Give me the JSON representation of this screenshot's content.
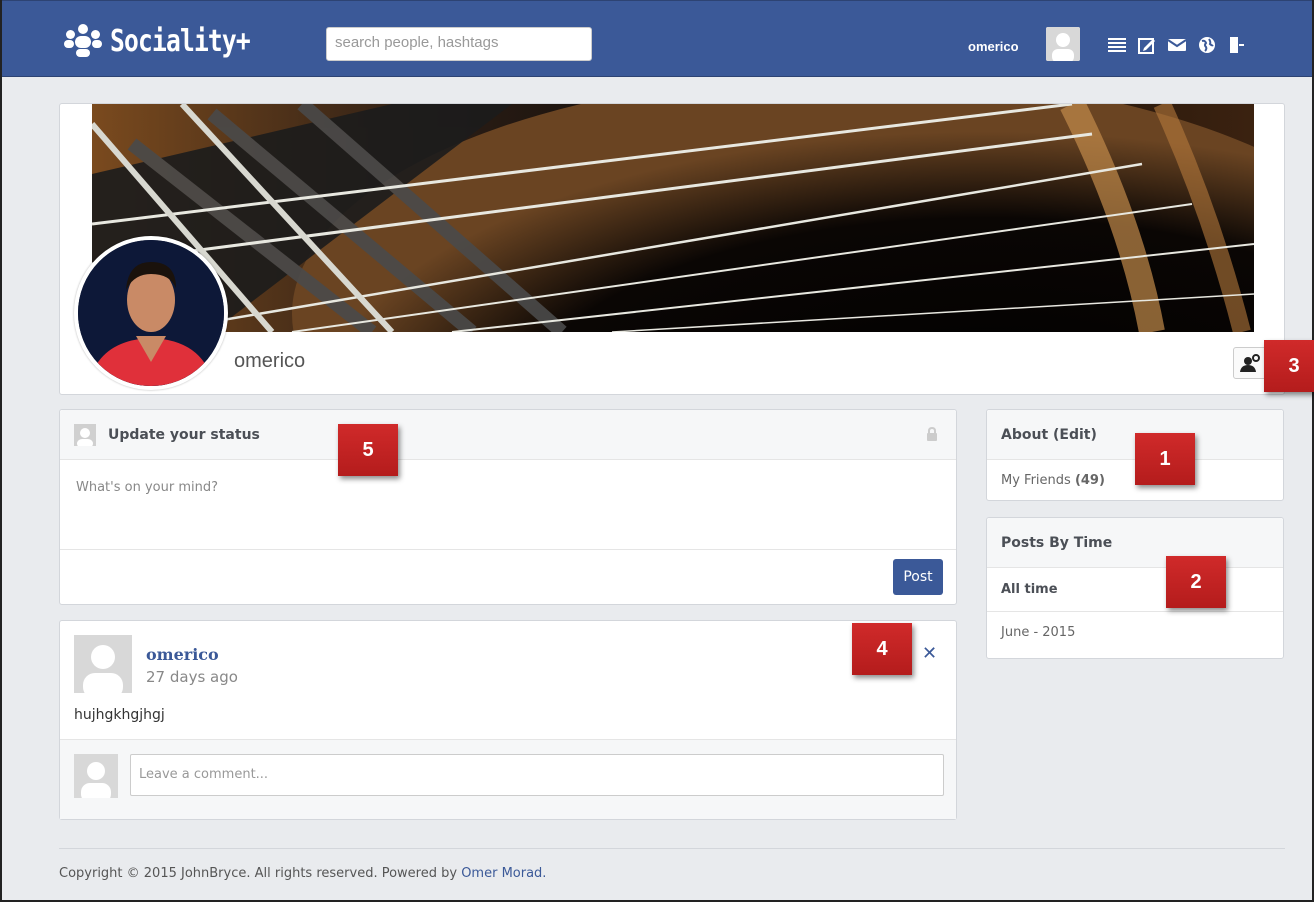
{
  "header": {
    "app_name": "Sociality+",
    "search_placeholder": "search people, hashtags",
    "username": "omerico",
    "nav_icons": [
      "list-icon",
      "edit-icon",
      "mail-icon",
      "globe-icon",
      "logout-icon"
    ]
  },
  "profile": {
    "name": "omerico",
    "settings_icon": "user-settings-icon"
  },
  "status": {
    "title": "Update your status",
    "placeholder": "What's on your mind?",
    "post_label": "Post"
  },
  "post": {
    "author": "omerico",
    "time": "27 days ago",
    "text": "hujhgkhgjhgj",
    "comment_placeholder": "Leave a comment..."
  },
  "about": {
    "title": "About (Edit)",
    "friends_label": "My Friends",
    "friends_count": "(49)"
  },
  "posts_by_time": {
    "title": "Posts By Time",
    "items": [
      "All time",
      "June - 2015"
    ]
  },
  "badges": [
    "1",
    "2",
    "3",
    "4",
    "5"
  ],
  "footer": {
    "text": "Copyright © 2015 JohnBryce. All rights reserved. Powered by",
    "link": "Omer Morad."
  },
  "colors": {
    "brand": "#3b5998",
    "badge": "#c62222",
    "background": "#e9ebee"
  }
}
